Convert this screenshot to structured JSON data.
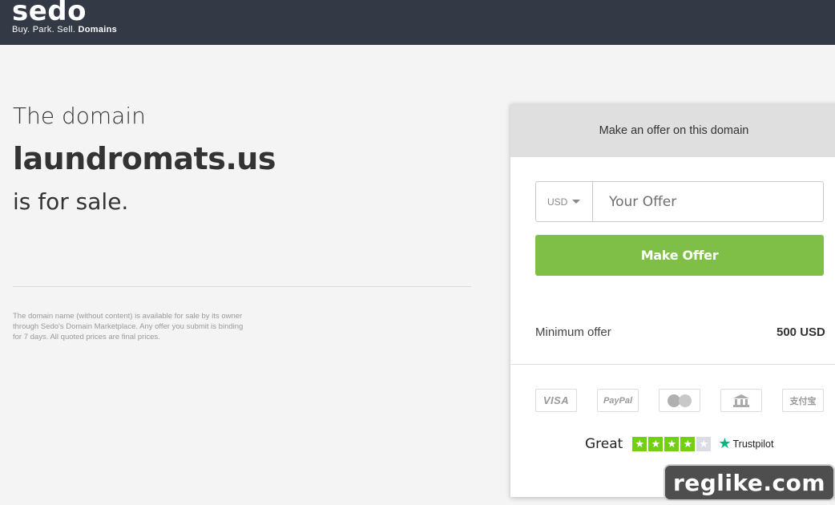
{
  "header": {
    "logo": "sedo",
    "tagline_prefix": "Buy. Park. Sell.",
    "tagline_bold": "Domains",
    "bg_color": "#343a45"
  },
  "main": {
    "pre_text": "The domain",
    "domain": "laundromats.us",
    "post_text": "is for sale.",
    "disclaimer": "The domain name (without content) is available for sale by its owner through Sedo's Domain Marketplace. Any offer you submit is binding for 7 days. All quoted prices are final prices."
  },
  "offer_panel": {
    "title": "Make an offer on this domain",
    "currency": "USD",
    "currency_icon": "caret-down-icon",
    "input_placeholder": "Your Offer",
    "input_value": "",
    "button_label": "Make Offer",
    "button_color": "#7fbf47",
    "min_offer_label": "Minimum offer",
    "min_offer_value": "500 USD"
  },
  "payments": [
    {
      "name": "visa-icon",
      "label": "VISA"
    },
    {
      "name": "paypal-icon",
      "label": "PayPal"
    },
    {
      "name": "mastercard-icon",
      "label": ""
    },
    {
      "name": "bank-transfer-icon",
      "label": ""
    },
    {
      "name": "alipay-icon",
      "label": "支付宝"
    }
  ],
  "trustpilot": {
    "rating_label": "Great",
    "stars_filled": 4,
    "stars_total": 5,
    "brand": "Trustpilot",
    "star_color": "#73cf11"
  },
  "watermark": {
    "text": "reglike.com"
  }
}
